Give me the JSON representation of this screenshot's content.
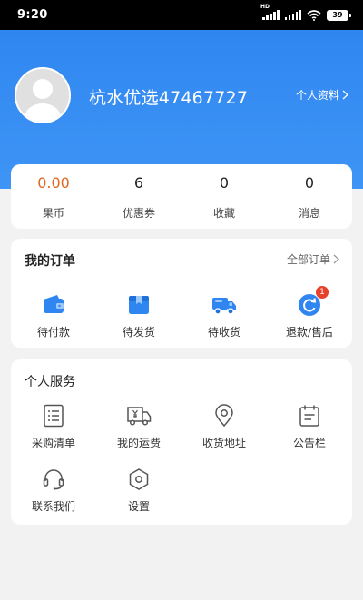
{
  "status_bar": {
    "time": "9:20",
    "network_badge": "HD",
    "battery": "39"
  },
  "profile": {
    "username": "杭水优选47467727",
    "profile_link": "个人资料"
  },
  "stats": [
    {
      "value": "0.00",
      "label": "果币"
    },
    {
      "value": "6",
      "label": "优惠券"
    },
    {
      "value": "0",
      "label": "收藏"
    },
    {
      "value": "0",
      "label": "消息"
    }
  ],
  "orders": {
    "title": "我的订单",
    "all_link": "全部订单",
    "items": [
      {
        "label": "待付款",
        "icon": "wallet-icon"
      },
      {
        "label": "待发货",
        "icon": "box-icon"
      },
      {
        "label": "待收货",
        "icon": "truck-icon"
      },
      {
        "label": "退款/售后",
        "icon": "refund-icon",
        "badge": "1"
      }
    ]
  },
  "services": {
    "title": "个人服务",
    "items": [
      {
        "label": "采购清单",
        "icon": "list-icon"
      },
      {
        "label": "我的运费",
        "icon": "freight-truck-icon"
      },
      {
        "label": "收货地址",
        "icon": "location-pin-icon"
      },
      {
        "label": "公告栏",
        "icon": "calendar-icon"
      },
      {
        "label": "联系我们",
        "icon": "headset-icon"
      },
      {
        "label": "设置",
        "icon": "settings-hexagon-icon"
      }
    ]
  },
  "colors": {
    "header_blue": "#3a8ff3",
    "accent_blue": "#2f86f0",
    "orange_value": "#e3661e",
    "badge_red": "#e7402b"
  }
}
